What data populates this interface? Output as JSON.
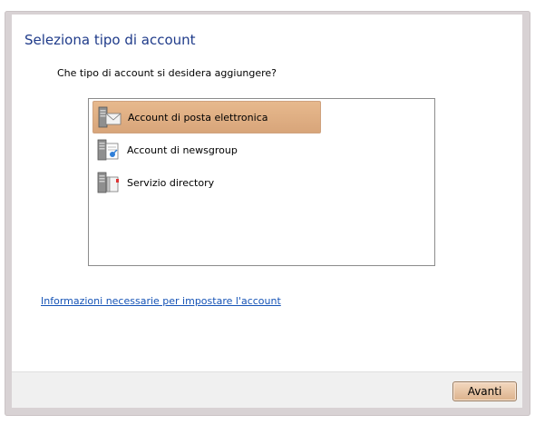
{
  "dialog": {
    "title": "Seleziona tipo di account",
    "question": "Che tipo di account si desidera aggiungere?",
    "account_types": [
      {
        "label": "Account di posta elettronica",
        "icon": "email-account-icon",
        "selected": true
      },
      {
        "label": "Account di newsgroup",
        "icon": "newsgroup-account-icon",
        "selected": false
      },
      {
        "label": "Servizio directory",
        "icon": "directory-service-icon",
        "selected": false
      }
    ],
    "info_link": "Informazioni necessarie per impostare l'account",
    "next_button": "Avanti"
  },
  "colors": {
    "title": "#1f3b8a",
    "selection": "#d8a57a",
    "link": "#1553b6",
    "footer": "#f0f0f0"
  }
}
